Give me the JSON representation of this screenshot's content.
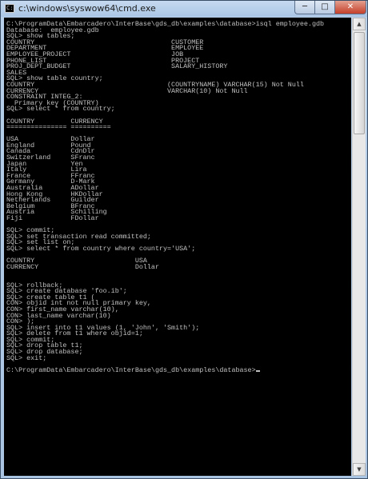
{
  "window": {
    "title": "c:\\windows\\syswow64\\cmd.exe",
    "icon_label": "C:\\",
    "controls": {
      "minimize": "─",
      "maximize": "□",
      "close": "✕"
    }
  },
  "scrollbar": {
    "up": "▲",
    "down": "▼"
  },
  "console": {
    "lines": [
      "C:\\ProgramData\\Embarcadero\\InterBase\\gds_db\\examples\\database>isql employee.gdb",
      "Database:  employee.gdb",
      "SQL> show tables;",
      "COUNTRY                                  CUSTOMER",
      "DEPARTMENT                               EMPLOYEE",
      "EMPLOYEE_PROJECT                         JOB",
      "PHONE_LIST                               PROJECT",
      "PROJ_DEPT_BUDGET                         SALARY_HISTORY",
      "SALES",
      "SQL> show table country;",
      "COUNTRY                                 (COUNTRYNAME) VARCHAR(15) Not Null",
      "CURRENCY                                VARCHAR(10) Not Null",
      "CONSTRAINT INTEG_2:",
      "  Primary key (COUNTRY)",
      "SQL> select * from country;",
      "",
      "COUNTRY         CURRENCY",
      "=============== ==========",
      "",
      "USA             Dollar",
      "England         Pound",
      "Canada          CdnDlr",
      "Switzerland     SFranc",
      "Japan           Yen",
      "Italy           Lira",
      "France          FFranc",
      "Germany         D-Mark",
      "Australia       ADollar",
      "Hong Kong       HKDollar",
      "Netherlands     Guilder",
      "Belgium         BFranc",
      "Austria         Schilling",
      "Fiji            FDollar",
      "",
      "SQL> commit;",
      "SQL> set transaction read committed;",
      "SQL> set list on;",
      "SQL> select * from country where country='USA';",
      "",
      "COUNTRY                         USA",
      "CURRENCY                        Dollar",
      "",
      "",
      "SQL> rollback;",
      "SQL> create database 'foo.ib';",
      "SQL> create table t1 (",
      "CON> objid int not null primary key,",
      "CON> first_name varchar(10),",
      "CON> last_name varchar(10)",
      "CON> );",
      "SQL> insert into t1 values (1, 'John', 'Smith');",
      "SQL> delete from t1 where objid=1;",
      "SQL> commit;",
      "SQL> drop table t1;",
      "SQL> drop database;",
      "SQL> exit;",
      "",
      "C:\\ProgramData\\Embarcadero\\InterBase\\gds_db\\examples\\database>"
    ]
  }
}
